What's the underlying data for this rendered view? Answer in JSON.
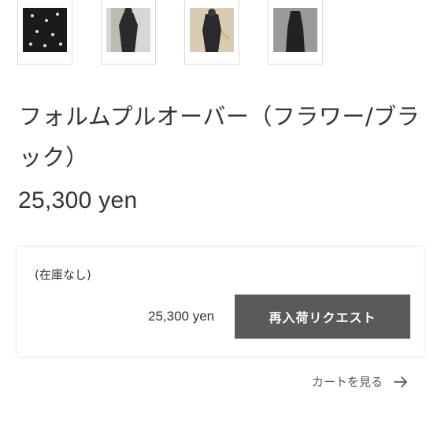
{
  "thumbnails": [
    {
      "icon": "thumbnail-flower-fabric"
    },
    {
      "icon": "thumbnail-model-front"
    },
    {
      "icon": "thumbnail-model-side"
    },
    {
      "icon": "thumbnail-model-full"
    }
  ],
  "product": {
    "title": "フォルムプルオーバー（フラワー/ブラック）",
    "price": "25,300 yen"
  },
  "purchase_box": {
    "stock_status": "(在庫なし)",
    "price": "25,300 yen",
    "restock_button_label": "再入荷リクエスト"
  },
  "cart_link": {
    "label": "カートを見る",
    "icon": "arrow-right-icon"
  },
  "colors": {
    "button_bg": "#5a5a5a",
    "text": "#333333"
  }
}
